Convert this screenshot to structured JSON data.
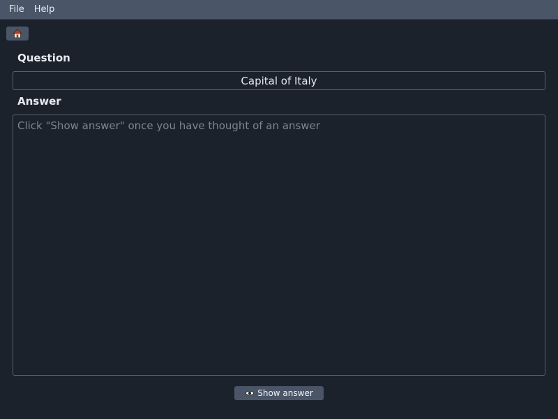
{
  "menubar": {
    "items": [
      {
        "label": "File"
      },
      {
        "label": "Help"
      }
    ]
  },
  "toolbar": {
    "home_icon": "home-icon"
  },
  "question": {
    "label": "Question",
    "value": "Capital of Italy"
  },
  "answer": {
    "label": "Answer",
    "placeholder": "Click \"Show answer\" once you have thought of an answer"
  },
  "actions": {
    "show_answer_label": "Show answer",
    "show_answer_icon": "eye-icon"
  },
  "colors": {
    "background": "#1b222c",
    "menubar": "#4a5667",
    "border": "#59626f",
    "placeholder": "#7d8590"
  }
}
